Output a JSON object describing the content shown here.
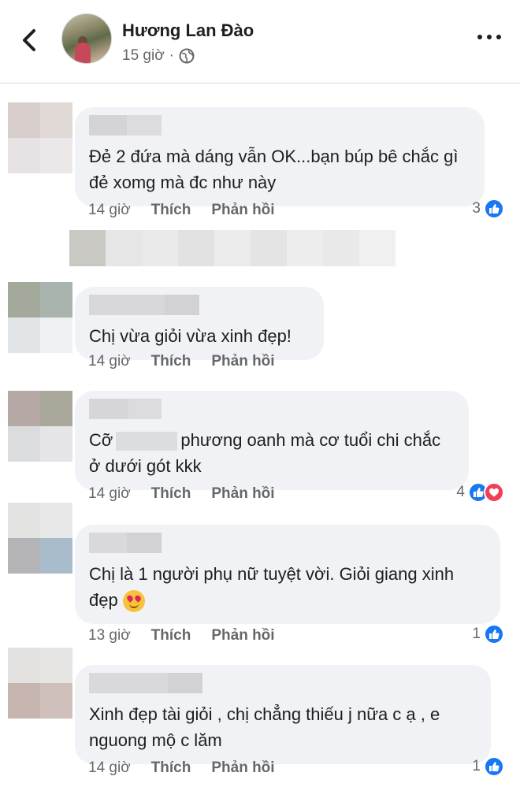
{
  "header": {
    "author": "Hương Lan Đào",
    "time": "15 giờ",
    "back_icon": "chevron-left-icon",
    "more_icon": "more-dots-icon",
    "privacy_icon": "globe-icon"
  },
  "actions": {
    "like": "Thích",
    "reply": "Phản hồi"
  },
  "comments": [
    {
      "text": "Đẻ 2 đứa mà dáng vẫn OK...bạn búp bê chắc gì đẻ xomg mà đc như này",
      "time": "14 giờ",
      "reactions": "3"
    },
    {
      "text": "Chị vừa giỏi vừa xinh đẹp!",
      "time": "14 giờ",
      "reactions": ""
    },
    {
      "text_a": "Cỡ",
      "text_b": "phương oanh mà cơ tuổi chi chắc ở dưới gót kkk",
      "time": "14 giờ",
      "reactions": "4"
    },
    {
      "text": "Chị là 1 người phụ nữ tuyệt vời. Giỏi giang xinh đẹp",
      "time": "13 giờ",
      "reactions": "1"
    },
    {
      "text": "Xinh đẹp tài giỏi , chị chẳng thiếu j nữa c ạ , e nguong mộ c lăm",
      "time": "14 giờ",
      "reactions": "1"
    }
  ],
  "colors": {
    "like_blue": "#1877f2",
    "heart_red": "#f33e58",
    "bubble": "#f0f2f5",
    "meta_gray": "#65676b"
  }
}
